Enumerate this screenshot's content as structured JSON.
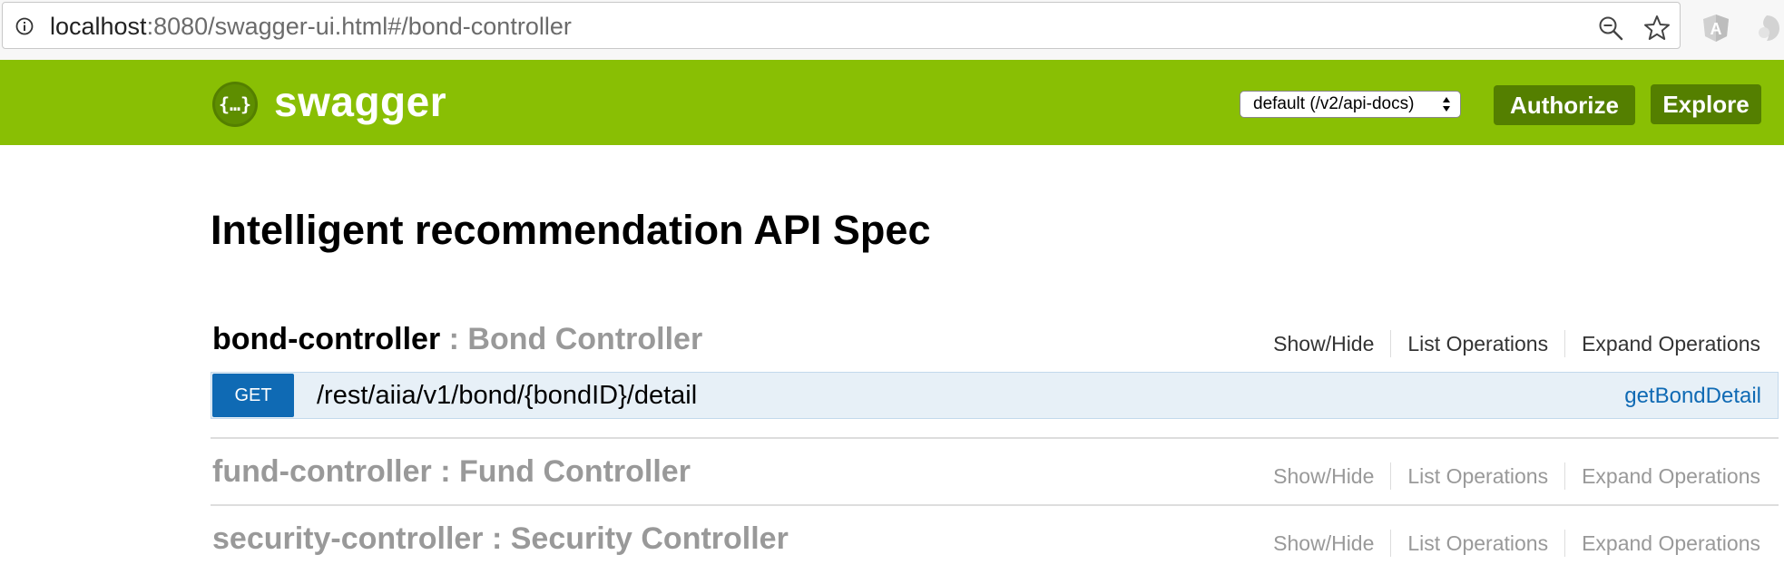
{
  "browser": {
    "url_host": "localhost",
    "url_rest": ":8080/swagger-ui.html#/bond-controller",
    "icons": [
      "info-icon",
      "zoom-out-icon",
      "bookmark-star-icon",
      "angular-extension-icon",
      "extension-icon"
    ]
  },
  "header": {
    "logo_symbol": "{…}",
    "logo_text": "swagger",
    "spec_select_value": "default (/v2/api-docs)",
    "authorize_label": "Authorize",
    "explore_label": "Explore",
    "colors": {
      "bar": "#89bf04",
      "button": "#547f00"
    }
  },
  "main": {
    "title": "Intelligent recommendation API Spec",
    "resources": [
      {
        "name": "bond-controller",
        "description": " : Bond Controller",
        "show_hide": "Show/Hide",
        "list_operations": "List Operations",
        "expand_operations": "Expand Operations",
        "operations": [
          {
            "method": "GET",
            "path": "/rest/aiia/v1/bond/{bondID}/detail",
            "operation_id": "getBondDetail"
          }
        ]
      },
      {
        "name": "fund-controller",
        "description": " : Fund Controller",
        "show_hide": "Show/Hide",
        "list_operations": "List Operations",
        "expand_operations": "Expand Operations"
      },
      {
        "name": "security-controller",
        "description": " : Security Controller",
        "show_hide": "Show/Hide",
        "list_operations": "List Operations",
        "expand_operations": "Expand Operations"
      }
    ],
    "colors": {
      "get_method": "#0f6ab4",
      "operation_bg": "#e7f0f7"
    }
  }
}
